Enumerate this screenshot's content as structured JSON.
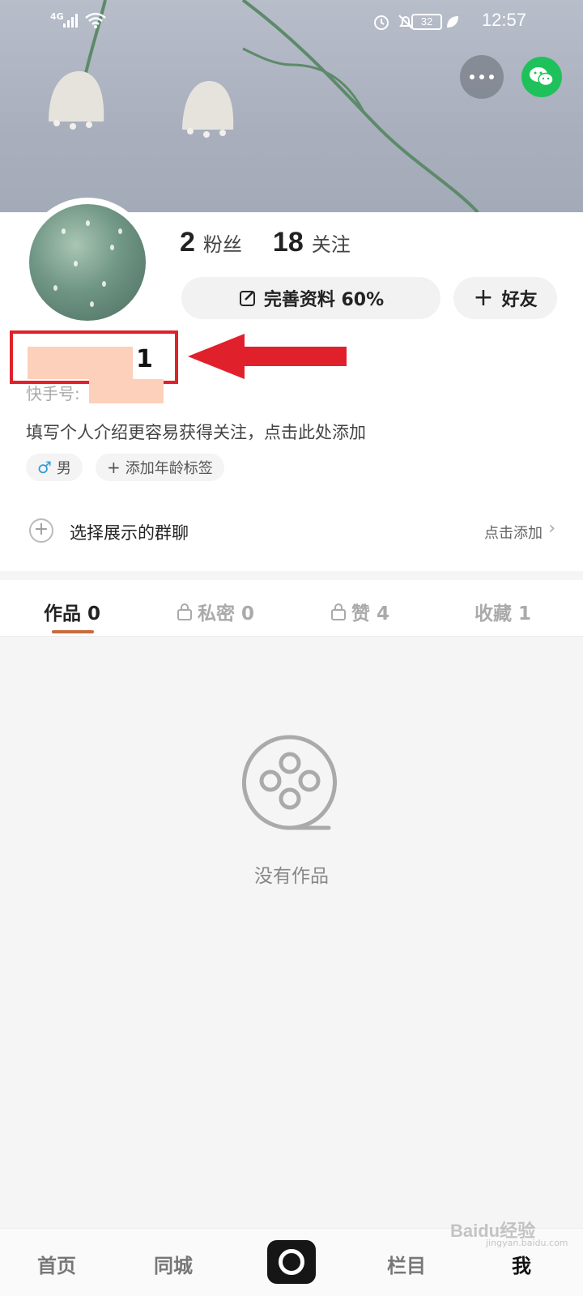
{
  "status_bar": {
    "network": "4G",
    "battery": "32",
    "time": "12:57"
  },
  "header": {
    "more_icon": "more-dots-icon",
    "share_icon": "wechat-icon",
    "share_color": "#1fc15b"
  },
  "profile": {
    "fans_count": "2",
    "fans_label": "粉丝",
    "following_count": "18",
    "following_label": "关注",
    "complete_label": "完善资料 60%",
    "complete_progress": 0.6,
    "friend_label": "好友",
    "name_suffix": "1",
    "kuaishou_id_label": "快手号:",
    "bio_placeholder": "填写个人介绍更容易获得关注，点击此处添加",
    "gender_tag": "男",
    "age_tag": "添加年龄标签",
    "group_label": "选择展示的群聊",
    "group_action": "点击添加",
    "highlight_color": "#e0212b"
  },
  "tabs": [
    {
      "label": "作品 0",
      "locked": false,
      "active": true
    },
    {
      "label": "私密 0",
      "locked": true,
      "active": false
    },
    {
      "label": "赞 4",
      "locked": true,
      "active": false
    },
    {
      "label": "收藏 1",
      "locked": false,
      "active": false
    }
  ],
  "empty_state": {
    "icon": "film-reel-icon",
    "text": "没有作品"
  },
  "bottom_nav": [
    {
      "label": "首页",
      "active": false
    },
    {
      "label": "同城",
      "active": false
    },
    {
      "label": "栏目",
      "active": false
    },
    {
      "label": "我",
      "active": true
    }
  ],
  "watermark": {
    "brand": "Baidu经验",
    "url": "jingyan.baidu.com"
  }
}
